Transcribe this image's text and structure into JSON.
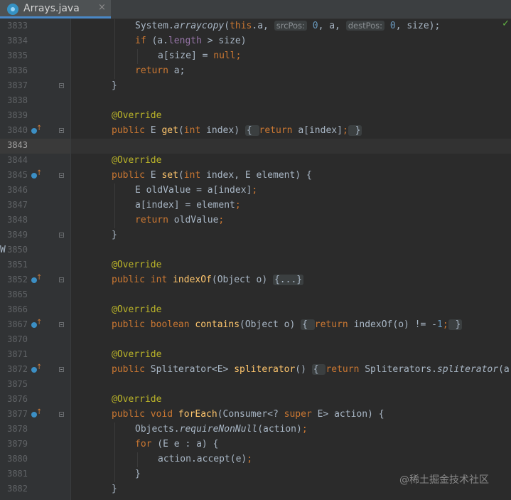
{
  "tab": {
    "title": "Arrays.java",
    "close_glyph": "×",
    "icon": "java-class-icon"
  },
  "status": {
    "inspection_glyph": "✓",
    "color": "#62b543"
  },
  "gutter": {
    "stray_glyph": "W"
  },
  "watermark": "@稀土掘金技术社区",
  "colors": {
    "keyword": "#cc7832",
    "annotation": "#bbb529",
    "method": "#ffc66d",
    "field": "#9876aa",
    "number": "#6897bb",
    "text": "#a9b7c6",
    "hint": "#8a8f93"
  },
  "lines": [
    {
      "num": "3833",
      "indent": 3,
      "tokens": [
        [
          "t",
          "System."
        ],
        [
          "st",
          "arraycopy"
        ],
        [
          "t",
          "("
        ],
        [
          "k",
          "this"
        ],
        [
          "t",
          ".a, "
        ],
        [
          "h",
          "srcPos:"
        ],
        [
          "t",
          " "
        ],
        [
          "n",
          "0"
        ],
        [
          "t",
          ", a, "
        ],
        [
          "h",
          "destPos:"
        ],
        [
          "t",
          " "
        ],
        [
          "n",
          "0"
        ],
        [
          "t",
          ", size);"
        ]
      ]
    },
    {
      "num": "3834",
      "indent": 3,
      "tokens": [
        [
          "k",
          "if"
        ],
        [
          "t",
          " (a."
        ],
        [
          "f",
          "length"
        ],
        [
          "t",
          " > size)"
        ]
      ]
    },
    {
      "num": "3835",
      "indent": 4,
      "tokens": [
        [
          "t",
          "a[size] = "
        ],
        [
          "k",
          "null"
        ],
        [
          "k",
          ";"
        ]
      ]
    },
    {
      "num": "3836",
      "indent": 3,
      "tokens": [
        [
          "k",
          "return"
        ],
        [
          "t",
          " a;"
        ]
      ]
    },
    {
      "num": "3837",
      "indent": 2,
      "fold": true,
      "tokens": [
        [
          "t",
          "}"
        ]
      ]
    },
    {
      "num": "3838",
      "indent": 2,
      "tokens": []
    },
    {
      "num": "3839",
      "indent": 2,
      "tokens": [
        [
          "a",
          "@Override"
        ]
      ]
    },
    {
      "num": "3840",
      "indent": 2,
      "marker": true,
      "fold": true,
      "tokens": [
        [
          "k",
          "public "
        ],
        [
          "t",
          "E "
        ],
        [
          "m",
          "get"
        ],
        [
          "t",
          "("
        ],
        [
          "k",
          "int"
        ],
        [
          "t",
          " index)"
        ],
        [
          "t",
          " "
        ],
        [
          "fr",
          "{ "
        ],
        [
          "k",
          "return"
        ],
        [
          "t",
          " a[index]"
        ],
        [
          "k",
          ";"
        ],
        [
          "fr",
          " }"
        ]
      ]
    },
    {
      "num": "3843",
      "indent": 2,
      "current": true,
      "tokens": []
    },
    {
      "num": "3844",
      "indent": 2,
      "tokens": [
        [
          "a",
          "@Override"
        ]
      ]
    },
    {
      "num": "3845",
      "indent": 2,
      "marker": true,
      "fold": true,
      "tokens": [
        [
          "k",
          "public "
        ],
        [
          "t",
          "E "
        ],
        [
          "m",
          "set"
        ],
        [
          "t",
          "("
        ],
        [
          "k",
          "int"
        ],
        [
          "t",
          " index, E element) {"
        ]
      ]
    },
    {
      "num": "3846",
      "indent": 3,
      "tokens": [
        [
          "t",
          "E oldValue = a[index]"
        ],
        [
          "k",
          ";"
        ]
      ]
    },
    {
      "num": "3847",
      "indent": 3,
      "tokens": [
        [
          "t",
          "a[index] = element"
        ],
        [
          "k",
          ";"
        ]
      ]
    },
    {
      "num": "3848",
      "indent": 3,
      "tokens": [
        [
          "k",
          "return"
        ],
        [
          "t",
          " oldValue"
        ],
        [
          "k",
          ";"
        ]
      ]
    },
    {
      "num": "3849",
      "indent": 2,
      "fold": true,
      "tokens": [
        [
          "t",
          "}"
        ]
      ]
    },
    {
      "num": "3850",
      "indent": 2,
      "tokens": []
    },
    {
      "num": "3851",
      "indent": 2,
      "tokens": [
        [
          "a",
          "@Override"
        ]
      ]
    },
    {
      "num": "3852",
      "indent": 2,
      "marker": true,
      "fold": true,
      "tokens": [
        [
          "k",
          "public int "
        ],
        [
          "m",
          "indexOf"
        ],
        [
          "t",
          "(Object o) "
        ],
        [
          "fr",
          "{...}"
        ]
      ]
    },
    {
      "num": "3865",
      "indent": 2,
      "tokens": []
    },
    {
      "num": "3866",
      "indent": 2,
      "tokens": [
        [
          "a",
          "@Override"
        ]
      ]
    },
    {
      "num": "3867",
      "indent": 2,
      "marker": true,
      "fold": true,
      "tokens": [
        [
          "k",
          "public boolean "
        ],
        [
          "m",
          "contains"
        ],
        [
          "t",
          "(Object o) "
        ],
        [
          "fr",
          "{ "
        ],
        [
          "k",
          "return"
        ],
        [
          "t",
          " indexOf(o) != -"
        ],
        [
          "n",
          "1"
        ],
        [
          "k",
          ";"
        ],
        [
          "fr",
          " }"
        ]
      ]
    },
    {
      "num": "3870",
      "indent": 2,
      "tokens": []
    },
    {
      "num": "3871",
      "indent": 2,
      "tokens": [
        [
          "a",
          "@Override"
        ]
      ]
    },
    {
      "num": "3872",
      "indent": 2,
      "marker": true,
      "fold": true,
      "tokens": [
        [
          "k",
          "public "
        ],
        [
          "t",
          "Spliterator<E> "
        ],
        [
          "m",
          "spliterator"
        ],
        [
          "t",
          "() "
        ],
        [
          "fr",
          "{ "
        ],
        [
          "k",
          "return"
        ],
        [
          "t",
          " Spliterators."
        ],
        [
          "st",
          "spliterator"
        ],
        [
          "t",
          "(a"
        ]
      ]
    },
    {
      "num": "3875",
      "indent": 2,
      "tokens": []
    },
    {
      "num": "3876",
      "indent": 2,
      "tokens": [
        [
          "a",
          "@Override"
        ]
      ]
    },
    {
      "num": "3877",
      "indent": 2,
      "marker": true,
      "fold": true,
      "tokens": [
        [
          "k",
          "public void "
        ],
        [
          "m",
          "forEach"
        ],
        [
          "t",
          "(Consumer<? "
        ],
        [
          "k",
          "super "
        ],
        [
          "t",
          "E> action) {"
        ]
      ]
    },
    {
      "num": "3878",
      "indent": 3,
      "tokens": [
        [
          "t",
          "Objects."
        ],
        [
          "st",
          "requireNonNull"
        ],
        [
          "t",
          "(action)"
        ],
        [
          "k",
          ";"
        ]
      ]
    },
    {
      "num": "3879",
      "indent": 3,
      "tokens": [
        [
          "k",
          "for"
        ],
        [
          "t",
          " (E e : a) {"
        ]
      ]
    },
    {
      "num": "3880",
      "indent": 4,
      "tokens": [
        [
          "t",
          "action.accept(e)"
        ],
        [
          "k",
          ";"
        ]
      ]
    },
    {
      "num": "3881",
      "indent": 3,
      "tokens": [
        [
          "t",
          "}"
        ]
      ]
    },
    {
      "num": "3882",
      "indent": 2,
      "tokens": [
        [
          "t",
          "}"
        ]
      ]
    }
  ]
}
